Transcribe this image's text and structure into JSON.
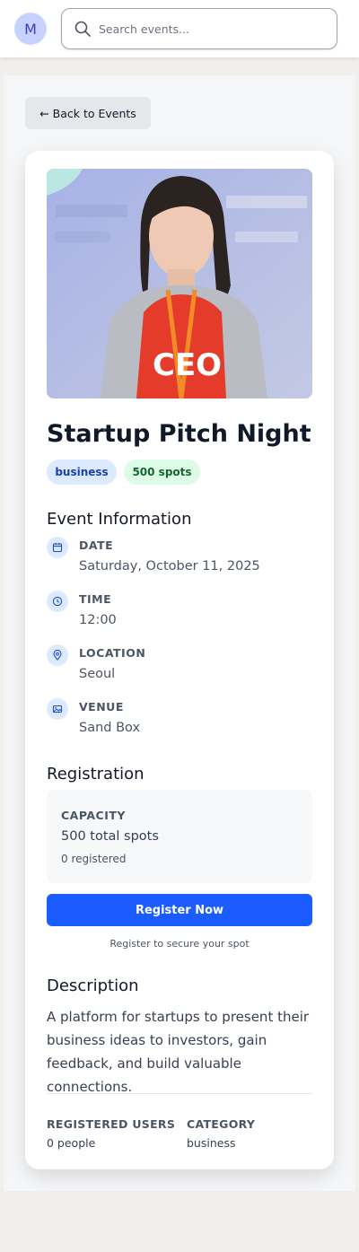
{
  "header": {
    "avatar_initial": "M",
    "search_placeholder": "Search events..."
  },
  "back_button": "← Back to Events",
  "event": {
    "title": "Startup Pitch Night",
    "category_tag": "business",
    "spots_tag": "500 spots",
    "photo_badge_text": "CEO"
  },
  "event_information": {
    "heading": "Event Information",
    "items": [
      {
        "label": "DATE",
        "value": "Saturday, October 11, 2025",
        "icon": "calendar-icon"
      },
      {
        "label": "TIME",
        "value": "12:00",
        "icon": "clock-icon"
      },
      {
        "label": "LOCATION",
        "value": "Seoul",
        "icon": "map-pin-icon"
      },
      {
        "label": "VENUE",
        "value": "Sand Box",
        "icon": "image-icon"
      }
    ]
  },
  "registration": {
    "heading": "Registration",
    "capacity_label": "CAPACITY",
    "capacity_value": "500 total spots",
    "registered_count": "0 registered",
    "button": "Register Now",
    "note": "Register to secure your spot"
  },
  "description": {
    "heading": "Description",
    "text": "A platform for startups to present their business ideas to investors, gain feedback, and build valuable connections."
  },
  "footer_stats": {
    "registered_users_label": "REGISTERED USERS",
    "registered_users_value": "0 people",
    "category_label": "CATEGORY",
    "category_value": "business"
  },
  "colors": {
    "accent": "#1a5cff",
    "category_tag_bg": "#dbeafe",
    "spots_tag_bg": "#dcfce7"
  }
}
